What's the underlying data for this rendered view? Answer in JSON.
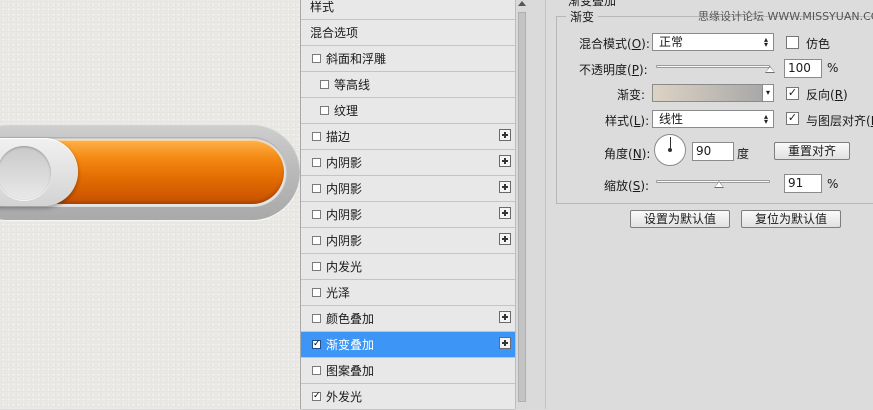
{
  "style_list": {
    "header": "样式",
    "blend_options": "混合选项",
    "items": [
      {
        "label": "斜面和浮雕",
        "checked": false,
        "has_plus": false,
        "indent": false
      },
      {
        "label": "等高线",
        "checked": false,
        "has_plus": false,
        "indent": true
      },
      {
        "label": "纹理",
        "checked": false,
        "has_plus": false,
        "indent": true
      },
      {
        "label": "描边",
        "checked": false,
        "has_plus": true,
        "indent": false
      },
      {
        "label": "内阴影",
        "checked": false,
        "has_plus": true,
        "indent": false
      },
      {
        "label": "内阴影",
        "checked": false,
        "has_plus": true,
        "indent": false
      },
      {
        "label": "内阴影",
        "checked": false,
        "has_plus": true,
        "indent": false
      },
      {
        "label": "内阴影",
        "checked": false,
        "has_plus": true,
        "indent": false
      },
      {
        "label": "内发光",
        "checked": false,
        "has_plus": false,
        "indent": false
      },
      {
        "label": "光泽",
        "checked": false,
        "has_plus": false,
        "indent": false
      },
      {
        "label": "颜色叠加",
        "checked": false,
        "has_plus": true,
        "indent": false
      },
      {
        "label": "渐变叠加",
        "checked": true,
        "has_plus": true,
        "indent": false,
        "selected": true
      },
      {
        "label": "图案叠加",
        "checked": false,
        "has_plus": false,
        "indent": false
      },
      {
        "label": "外发光",
        "checked": true,
        "has_plus": false,
        "indent": false
      }
    ]
  },
  "settings": {
    "section_title_partial": "渐变叠加",
    "group_label": "渐变",
    "watermark": "思缘设计论坛 WWW.MISSYUAN.COM",
    "blend_mode": {
      "label": "混合模式",
      "key": "O",
      "value": "正常"
    },
    "dither": {
      "label": "仿色",
      "checked": false
    },
    "opacity": {
      "label": "不透明度",
      "key": "P",
      "value": "100",
      "unit": "%",
      "fraction": 1.0
    },
    "gradient": {
      "label": "渐变",
      "colors": [
        "#ddd3c3",
        "#a8a8a8"
      ]
    },
    "reverse": {
      "label": "反向",
      "key": "R",
      "checked": true
    },
    "style": {
      "label": "样式",
      "key": "L",
      "value": "线性"
    },
    "align_with_layer": {
      "label": "与图层对齐",
      "key": "I",
      "checked": true
    },
    "angle": {
      "label": "角度",
      "key": "N",
      "value": "90",
      "unit": "度"
    },
    "reset_align": "重置对齐",
    "scale": {
      "label": "缩放",
      "key": "S",
      "value": "91",
      "unit": "%",
      "fraction": 0.55
    },
    "set_default": "设置为默认值",
    "reset_default": "复位为默认值"
  },
  "colors": {
    "selection": "#3d96f5",
    "orange_fill": "#f07c0a"
  }
}
